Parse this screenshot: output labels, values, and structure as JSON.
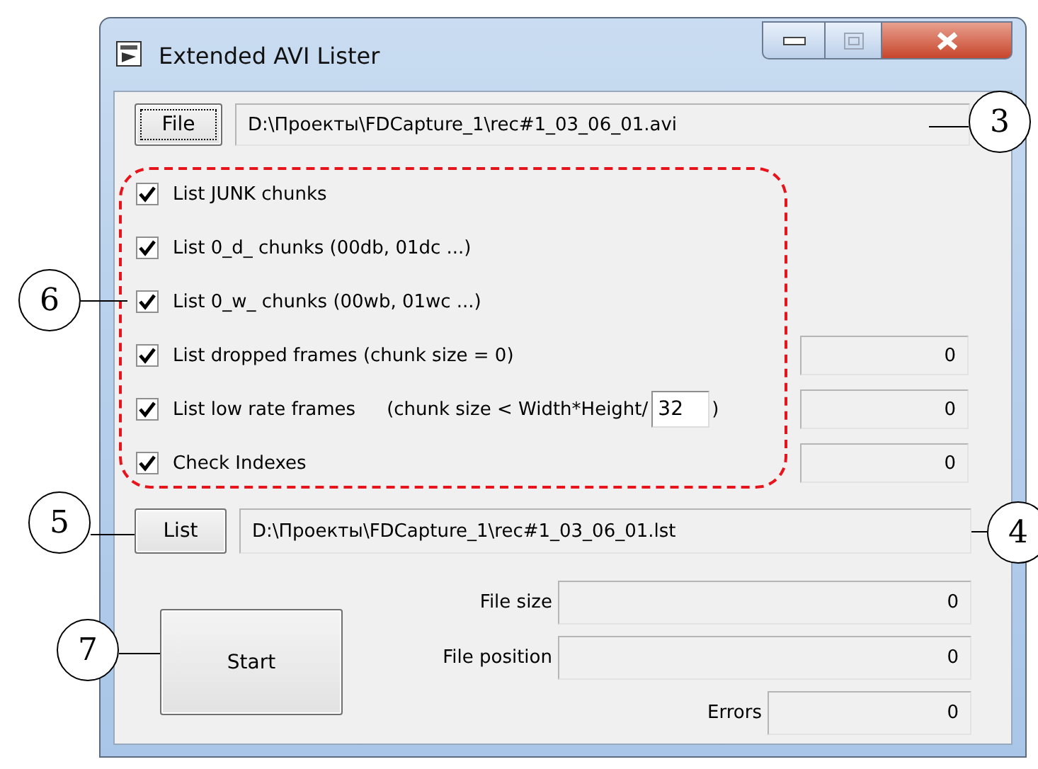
{
  "window": {
    "title": "Extended AVI Lister"
  },
  "file_button": {
    "label": "File",
    "focused": true
  },
  "file_path": {
    "value": "D:\\Проекты\\FDCapture_1\\rec#1_03_06_01.avi"
  },
  "options": [
    {
      "label": "List JUNK chunks",
      "checked": true
    },
    {
      "label": "List 0_d_ chunks (00db, 01dc ...)",
      "checked": true
    },
    {
      "label": "List 0_w_ chunks (00wb, 01wc ...)",
      "checked": true
    },
    {
      "label": "List dropped frames (chunk size = 0)",
      "checked": true,
      "count": "0"
    },
    {
      "label": "List low rate frames",
      "checked": true,
      "note": "(chunk size < Width*Height/",
      "divisor": "32",
      "note_end": ")",
      "count": "0"
    },
    {
      "label": "Check Indexes",
      "checked": true,
      "count": "0"
    }
  ],
  "list_button": {
    "label": "List"
  },
  "list_path": {
    "value": "D:\\Проекты\\FDCapture_1\\rec#1_03_06_01.lst"
  },
  "start_button": {
    "label": "Start"
  },
  "stats": [
    {
      "label": "File size",
      "value": "0"
    },
    {
      "label": "File position",
      "value": "0"
    },
    {
      "label": "Errors",
      "value": "0"
    }
  ],
  "callouts": [
    {
      "number": "3"
    },
    {
      "number": "4"
    },
    {
      "number": "5"
    },
    {
      "number": "6"
    },
    {
      "number": "7"
    }
  ]
}
